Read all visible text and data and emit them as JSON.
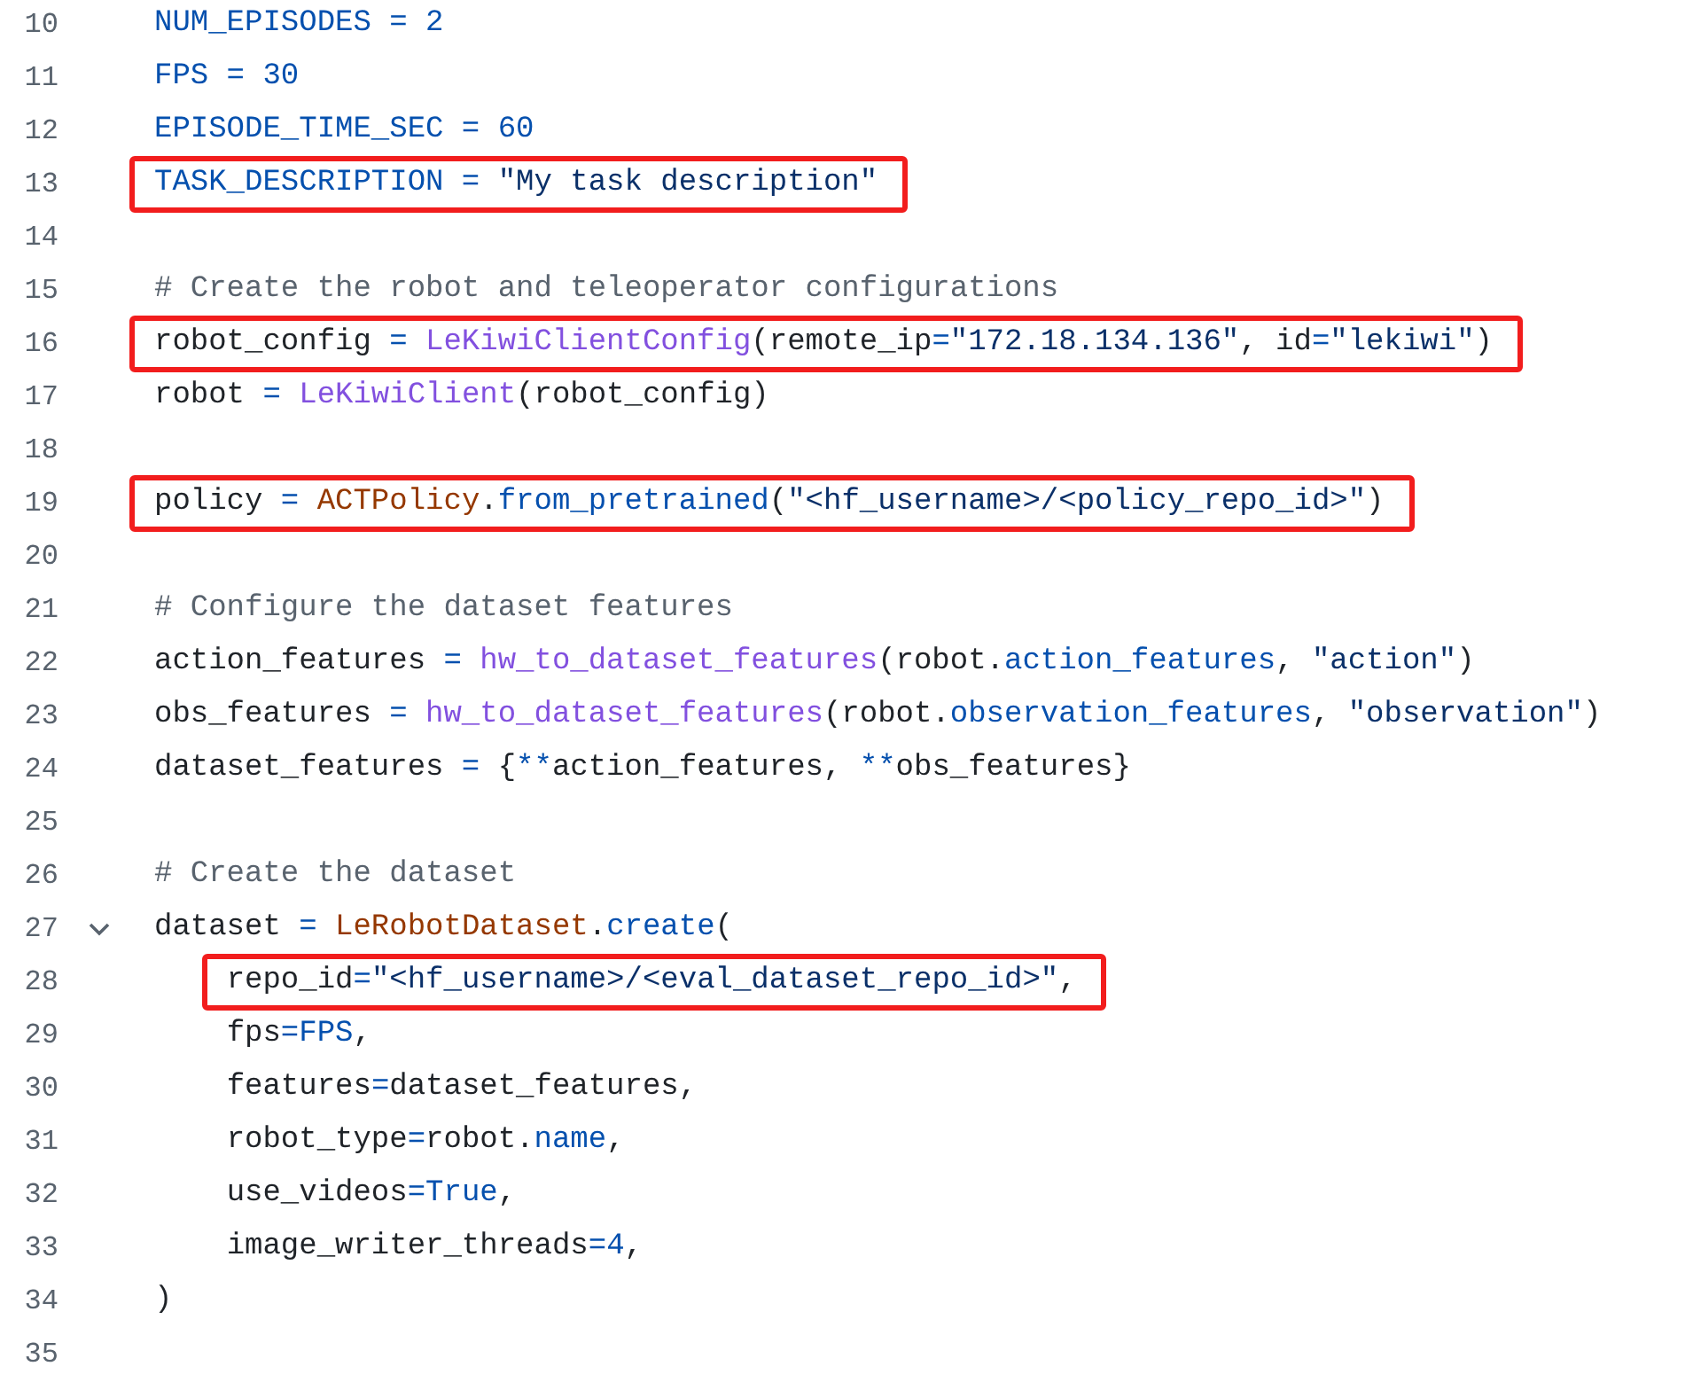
{
  "code_lines": [
    {
      "number": "10",
      "tokens": [
        {
          "kind": "const",
          "text": "NUM_EPISODES"
        },
        {
          "kind": "op",
          "text": " = "
        },
        {
          "kind": "num",
          "text": "2"
        }
      ]
    },
    {
      "number": "11",
      "tokens": [
        {
          "kind": "const",
          "text": "FPS"
        },
        {
          "kind": "op",
          "text": " = "
        },
        {
          "kind": "num",
          "text": "30"
        }
      ]
    },
    {
      "number": "12",
      "tokens": [
        {
          "kind": "const",
          "text": "EPISODE_TIME_SEC"
        },
        {
          "kind": "op",
          "text": " = "
        },
        {
          "kind": "num",
          "text": "60"
        }
      ]
    },
    {
      "number": "13",
      "highlighted": true,
      "tokens": [
        {
          "kind": "const",
          "text": "TASK_DESCRIPTION"
        },
        {
          "kind": "op",
          "text": " = "
        },
        {
          "kind": "str",
          "text": "\"My task description\""
        }
      ]
    },
    {
      "number": "14"
    },
    {
      "number": "15",
      "tokens": [
        {
          "kind": "comment",
          "text": "# Create the robot and teleoperator configurations"
        }
      ]
    },
    {
      "number": "16",
      "highlighted": true,
      "tokens": [
        {
          "kind": "plain",
          "text": "robot_config"
        },
        {
          "kind": "op",
          "text": " = "
        },
        {
          "kind": "func",
          "text": "LeKiwiClientConfig"
        },
        {
          "kind": "plain",
          "text": "(remote_ip"
        },
        {
          "kind": "op",
          "text": "="
        },
        {
          "kind": "str",
          "text": "\"172.18.134.136\""
        },
        {
          "kind": "plain",
          "text": ", id"
        },
        {
          "kind": "op",
          "text": "="
        },
        {
          "kind": "str",
          "text": "\"lekiwi\""
        },
        {
          "kind": "plain",
          "text": ")"
        }
      ]
    },
    {
      "number": "17",
      "tokens": [
        {
          "kind": "plain",
          "text": "robot"
        },
        {
          "kind": "op",
          "text": " = "
        },
        {
          "kind": "func",
          "text": "LeKiwiClient"
        },
        {
          "kind": "plain",
          "text": "(robot_config)"
        }
      ]
    },
    {
      "number": "18"
    },
    {
      "number": "19",
      "highlighted": true,
      "tokens": [
        {
          "kind": "plain",
          "text": "policy"
        },
        {
          "kind": "op",
          "text": " = "
        },
        {
          "kind": "cls",
          "text": "ACTPolicy"
        },
        {
          "kind": "plain",
          "text": "."
        },
        {
          "kind": "attr",
          "text": "from_pretrained"
        },
        {
          "kind": "plain",
          "text": "("
        },
        {
          "kind": "str",
          "text": "\"<hf_username>/<policy_repo_id>\""
        },
        {
          "kind": "plain",
          "text": ")"
        }
      ]
    },
    {
      "number": "20"
    },
    {
      "number": "21",
      "tokens": [
        {
          "kind": "comment",
          "text": "# Configure the dataset features"
        }
      ]
    },
    {
      "number": "22",
      "tokens": [
        {
          "kind": "plain",
          "text": "action_features"
        },
        {
          "kind": "op",
          "text": " = "
        },
        {
          "kind": "func",
          "text": "hw_to_dataset_features"
        },
        {
          "kind": "plain",
          "text": "(robot."
        },
        {
          "kind": "attr",
          "text": "action_features"
        },
        {
          "kind": "plain",
          "text": ", "
        },
        {
          "kind": "str",
          "text": "\"action\""
        },
        {
          "kind": "plain",
          "text": ")"
        }
      ]
    },
    {
      "number": "23",
      "tokens": [
        {
          "kind": "plain",
          "text": "obs_features"
        },
        {
          "kind": "op",
          "text": " = "
        },
        {
          "kind": "func",
          "text": "hw_to_dataset_features"
        },
        {
          "kind": "plain",
          "text": "(robot."
        },
        {
          "kind": "attr",
          "text": "observation_features"
        },
        {
          "kind": "plain",
          "text": ", "
        },
        {
          "kind": "str",
          "text": "\"observation\""
        },
        {
          "kind": "plain",
          "text": ")"
        }
      ]
    },
    {
      "number": "24",
      "tokens": [
        {
          "kind": "plain",
          "text": "dataset_features"
        },
        {
          "kind": "op",
          "text": " = "
        },
        {
          "kind": "plain",
          "text": "{"
        },
        {
          "kind": "op",
          "text": "**"
        },
        {
          "kind": "plain",
          "text": "action_features, "
        },
        {
          "kind": "op",
          "text": "**"
        },
        {
          "kind": "plain",
          "text": "obs_features}"
        }
      ]
    },
    {
      "number": "25"
    },
    {
      "number": "26",
      "tokens": [
        {
          "kind": "comment",
          "text": "# Create the dataset"
        }
      ]
    },
    {
      "number": "27",
      "expanded": true,
      "tokens": [
        {
          "kind": "plain",
          "text": "dataset"
        },
        {
          "kind": "op",
          "text": " = "
        },
        {
          "kind": "cls",
          "text": "LeRobotDataset"
        },
        {
          "kind": "plain",
          "text": "."
        },
        {
          "kind": "attr",
          "text": "create"
        },
        {
          "kind": "plain",
          "text": "("
        }
      ]
    },
    {
      "number": "28",
      "highlighted": true,
      "tokens": [
        {
          "kind": "plain",
          "text": "    repo_id"
        },
        {
          "kind": "op",
          "text": "="
        },
        {
          "kind": "str",
          "text": "\"<hf_username>/<eval_dataset_repo_id>\""
        },
        {
          "kind": "plain",
          "text": ","
        }
      ]
    },
    {
      "number": "29",
      "tokens": [
        {
          "kind": "plain",
          "text": "    fps"
        },
        {
          "kind": "op",
          "text": "="
        },
        {
          "kind": "const",
          "text": "FPS"
        },
        {
          "kind": "plain",
          "text": ","
        }
      ]
    },
    {
      "number": "30",
      "tokens": [
        {
          "kind": "plain",
          "text": "    features"
        },
        {
          "kind": "op",
          "text": "="
        },
        {
          "kind": "plain",
          "text": "dataset_features,"
        }
      ]
    },
    {
      "number": "31",
      "tokens": [
        {
          "kind": "plain",
          "text": "    robot_type"
        },
        {
          "kind": "op",
          "text": "="
        },
        {
          "kind": "plain",
          "text": "robot."
        },
        {
          "kind": "attr",
          "text": "name"
        },
        {
          "kind": "plain",
          "text": ","
        }
      ]
    },
    {
      "number": "32",
      "tokens": [
        {
          "kind": "plain",
          "text": "    use_videos"
        },
        {
          "kind": "op",
          "text": "="
        },
        {
          "kind": "num",
          "text": "True"
        },
        {
          "kind": "plain",
          "text": ","
        }
      ]
    },
    {
      "number": "33",
      "tokens": [
        {
          "kind": "plain",
          "text": "    image_writer_threads"
        },
        {
          "kind": "op",
          "text": "="
        },
        {
          "kind": "num",
          "text": "4"
        },
        {
          "kind": "plain",
          "text": ","
        }
      ]
    },
    {
      "number": "34",
      "tokens": [
        {
          "kind": "plain",
          "text": ")"
        }
      ]
    },
    {
      "number": "35"
    }
  ]
}
